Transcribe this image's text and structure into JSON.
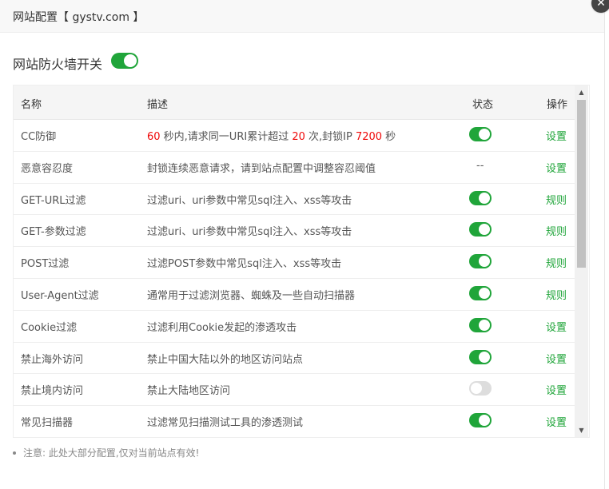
{
  "dialog": {
    "title": "网站配置【 gystv.com 】",
    "close_icon": "close-icon"
  },
  "firewall": {
    "label": "网站防火墙开关",
    "enabled": true
  },
  "colors": {
    "accent": "#20a53a",
    "highlight": "#ef0808"
  },
  "table": {
    "headers": {
      "name": "名称",
      "desc": "描述",
      "state": "状态",
      "op": "操作"
    },
    "cc_desc": {
      "n1": "60",
      "t1": " 秒内,请求同一URI累计超过 ",
      "n2": "20",
      "t2": " 次,封锁IP ",
      "n3": "7200",
      "t3": " 秒"
    },
    "rows": [
      {
        "name": "CC防御",
        "desc": "",
        "state": "on",
        "op": "设置"
      },
      {
        "name": "恶意容忍度",
        "desc": "封锁连续恶意请求，请到站点配置中调整容忍阈值",
        "state": "--",
        "op": "设置"
      },
      {
        "name": "GET-URL过滤",
        "desc": "过滤uri、uri参数中常见sql注入、xss等攻击",
        "state": "on",
        "op": "规则"
      },
      {
        "name": "GET-参数过滤",
        "desc": "过滤uri、uri参数中常见sql注入、xss等攻击",
        "state": "on",
        "op": "规则"
      },
      {
        "name": "POST过滤",
        "desc": "过滤POST参数中常见sql注入、xss等攻击",
        "state": "on",
        "op": "规则"
      },
      {
        "name": "User-Agent过滤",
        "desc": "通常用于过滤浏览器、蜘蛛及一些自动扫描器",
        "state": "on",
        "op": "规则"
      },
      {
        "name": "Cookie过滤",
        "desc": "过滤利用Cookie发起的渗透攻击",
        "state": "on",
        "op": "设置"
      },
      {
        "name": "禁止海外访问",
        "desc": "禁止中国大陆以外的地区访问站点",
        "state": "on",
        "op": "设置"
      },
      {
        "name": "禁止境内访问",
        "desc": "禁止大陆地区访问",
        "state": "off",
        "op": "设置"
      },
      {
        "name": "常见扫描器",
        "desc": "过滤常见扫描测试工具的渗透测试",
        "state": "on",
        "op": "设置"
      }
    ]
  },
  "note": "注意: 此处大部分配置,仅对当前站点有效!"
}
